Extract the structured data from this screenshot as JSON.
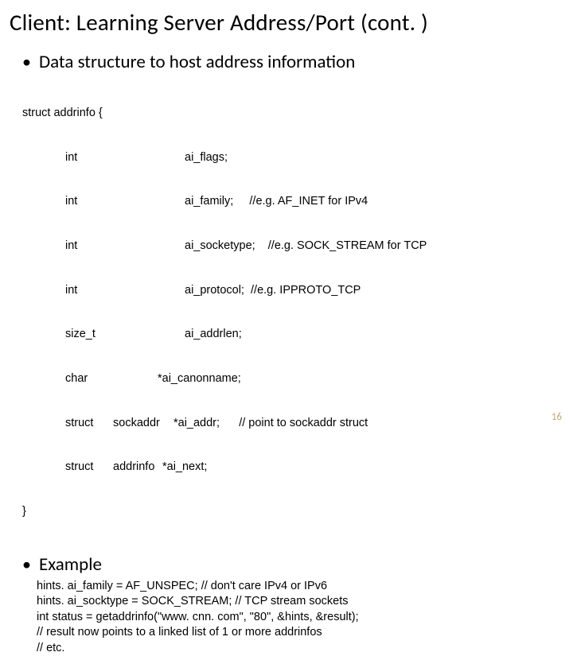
{
  "title": "Client: Learning Server Address/Port (cont. )",
  "bullets": {
    "b1": "Data structure to host address information",
    "b2": "Example"
  },
  "struct": {
    "open": "struct addrinfo {",
    "close": "}",
    "fields": [
      {
        "type": "int",
        "mid": "",
        "name": "ai_flags;"
      },
      {
        "type": "int",
        "mid": "",
        "name": "ai_family;     //e.g. AF_INET for IPv4"
      },
      {
        "type": "int",
        "mid": "",
        "name": "ai_socketype;    //e.g. SOCK_STREAM for TCP"
      },
      {
        "type": "int",
        "mid": "",
        "name": "ai_protocol;  //e.g. IPPROTO_TCP"
      },
      {
        "type": "size_t",
        "mid": "",
        "name": "ai_addrlen;"
      },
      {
        "type": "char",
        "mid": "",
        "name": "*ai_canonname;",
        "shift": "canon"
      },
      {
        "type": "struct",
        "mid": "sockaddr",
        "name": "*ai_addr;      // point to sockaddr struct",
        "shift": "addr"
      },
      {
        "type": "struct",
        "mid": "addrinfo",
        "name": "*ai_next;",
        "shift": "next"
      }
    ]
  },
  "example": {
    "l1": "hints. ai_family = AF_UNSPEC;     // don't care IPv4 or IPv6",
    "l2": "hints. ai_socktype = SOCK_STREAM; // TCP stream sockets",
    "l3": "int status = getaddrinfo(\"www. cnn. com\", \"80\", &hints, &result);",
    "l4": "// result now points to a linked list of 1 or more addrinfos",
    "l5": "// etc."
  },
  "pagenum": "16"
}
